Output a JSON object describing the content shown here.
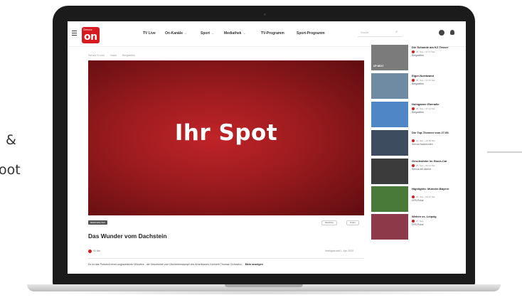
{
  "side_text": {
    "amp": "&",
    "pot": "oot"
  },
  "nav": {
    "logo_small": "Servus",
    "logo_main": "on",
    "items": [
      {
        "label": "TV Live",
        "has_chevron": false
      },
      {
        "label": "On-Kanäle",
        "has_chevron": true
      },
      {
        "label": "Sport",
        "has_chevron": true
      },
      {
        "label": "Mediathek",
        "has_chevron": true
      },
      {
        "label": "TV-Programm",
        "has_chevron": false
      },
      {
        "label": "Sport-Programm",
        "has_chevron": false
      }
    ],
    "chevron": "⌄",
    "search_placeholder": "Suche",
    "search_icon": "search-icon"
  },
  "breadcrumb": [
    "ServusTV.com",
    "Natur",
    "Bergwelten"
  ],
  "player": {
    "overlay_text": "Ihr Spot",
    "background": "#a81f23"
  },
  "video": {
    "tag": "BERGWELTEN",
    "buttons": [
      "Merkliste",
      "Teilen"
    ],
    "title": "Das Wunder vom Dachstein",
    "duration": "90 Min",
    "available": "Verfügbar seit 1. Apr. 2020",
    "description": "Es ist das Protokoll eines unglaublichen Wunders - die Geschichte vom Überlebenskampf des Amerikaners Kenneth Thomas Cichowicz.",
    "more_label": "Mehr anzeigen"
  },
  "sidebar": [
    {
      "title": "Die Schande am KZ-Tesser",
      "meta": "25. Sep. | 47:17 Min",
      "sub": "Bergwelten",
      "badge": "UP NEXT",
      "thumb": "#7b7b7b"
    },
    {
      "title": "Eiger-Nordwand",
      "meta": "25. Sep. | 47:07 Min",
      "sub": "Bergwelten",
      "badge": "",
      "thumb": "#6f8aa3"
    },
    {
      "title": "Hoingamer Ebenalle",
      "meta": "25. Sep. | 47:14 Min",
      "sub": "Bergwelten",
      "badge": "",
      "thumb": "#4f86c6"
    },
    {
      "title": "Die Top-Themen vom 27.09.",
      "meta": "27. Sep. | 10:56 Min",
      "sub": "Servus Nachrichten",
      "badge": "",
      "thumb": "#3d4d5f"
    },
    {
      "title": "Geschwister im Stock-Car",
      "meta": "25. Sep. | 50:14 Min",
      "sub": "Servus am Abend",
      "badge": "",
      "thumb": "#3b3b3b"
    },
    {
      "title": "Highlights: Münster-Bayern",
      "meta": "26. Sep. | 04:07 Min",
      "sub": "DFB-Pokal",
      "badge": "",
      "thumb": "#4a7a3a"
    },
    {
      "title": "Wehen vs. Leipzig",
      "meta": "27. Sep.",
      "sub": "DFB-Pokal",
      "badge": "",
      "thumb": "#8c3a4a"
    }
  ]
}
